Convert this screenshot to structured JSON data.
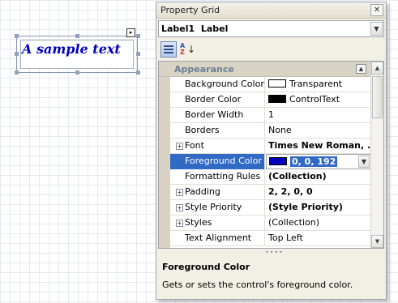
{
  "design_surface": {
    "label_text": "A sample text",
    "label_color": "#0000c0"
  },
  "property_grid": {
    "title": "Property Grid",
    "close_icon": "close-icon",
    "component": {
      "name": "Label1",
      "type": "Label"
    },
    "toolbar": {
      "categorized_icon": "categorized-icon",
      "alphabetical_icon": "sort-alpha-icon"
    },
    "category": "Appearance",
    "properties": [
      {
        "name": "Background Color",
        "value": "Transparent",
        "swatch": "#ffffff",
        "expandable": false,
        "bold": false
      },
      {
        "name": "Border Color",
        "value": "ControlText",
        "swatch": "#000000",
        "expandable": false,
        "bold": false
      },
      {
        "name": "Border Width",
        "value": "1",
        "expandable": false,
        "bold": false
      },
      {
        "name": "Borders",
        "value": "None",
        "expandable": false,
        "bold": false
      },
      {
        "name": "Font",
        "value": "Times New Roman, ...",
        "expandable": true,
        "bold": true
      },
      {
        "name": "Foreground Color",
        "value": "0, 0, 192",
        "swatch": "#0000c0",
        "expandable": false,
        "bold": true,
        "selected": true
      },
      {
        "name": "Formatting Rules",
        "value": "(Collection)",
        "expandable": false,
        "bold": true
      },
      {
        "name": "Padding",
        "value": "2, 2, 0, 0",
        "expandable": true,
        "bold": true
      },
      {
        "name": "Style Priority",
        "value": "(Style Priority)",
        "expandable": true,
        "bold": true
      },
      {
        "name": "Styles",
        "value": "(Collection)",
        "expandable": true,
        "bold": false
      },
      {
        "name": "Text Alignment",
        "value": "Top Left",
        "expandable": false,
        "bold": false
      }
    ],
    "description": {
      "title": "Foreground Color",
      "text": "Gets or sets the control's foreground color."
    },
    "selection_color": "#316ac5"
  }
}
